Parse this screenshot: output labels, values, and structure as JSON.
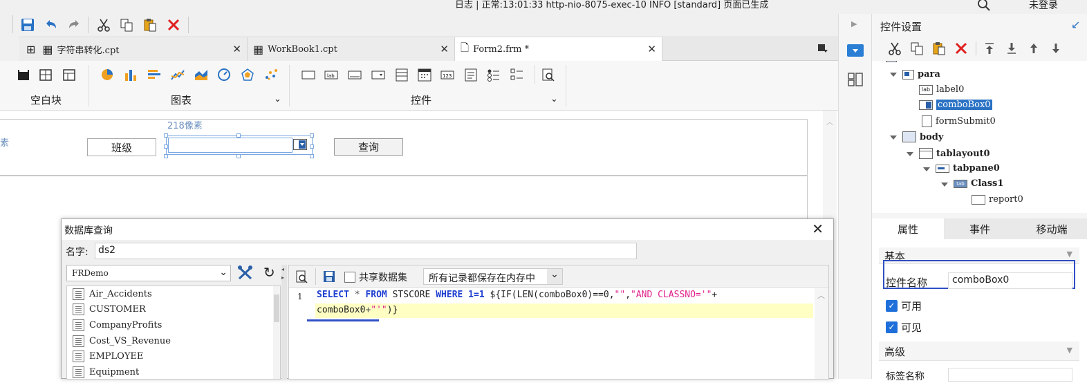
{
  "status": {
    "log_text": "日志 | 正常:13:01:33 http-nio-8075-exec-10 INFO [standard] 页面已生成",
    "login_text": "未登录"
  },
  "tabs": [
    {
      "label": "字符串转化.cpt"
    },
    {
      "label": "WorkBook1.cpt"
    },
    {
      "label": "Form2.frm *"
    }
  ],
  "ribbon": {
    "group1": "空白块",
    "group2": "图表",
    "group3": "控件"
  },
  "canvas": {
    "left_px_label": "素",
    "width_hint": "218像素",
    "class_label": "班级",
    "query_button": "查询"
  },
  "right_panel": {
    "title": "控件设置",
    "tree": [
      {
        "label": "para"
      },
      {
        "label": "label0"
      },
      {
        "label": "comboBox0"
      },
      {
        "label": "formSubmit0"
      },
      {
        "label": "body"
      },
      {
        "label": "tablayout0"
      },
      {
        "label": "tabpane0"
      },
      {
        "label": "Class1"
      },
      {
        "label": "report0"
      }
    ],
    "tabs": [
      "属性",
      "事件",
      "移动端"
    ],
    "section_basic": "基本",
    "widget_name_label": "控件名称",
    "widget_name_value": "comboBox0",
    "enabled_label": "可用",
    "visible_label": "可见",
    "section_advanced": "高级",
    "tag_name_label": "标签名称"
  },
  "dialog": {
    "title": "数据库查询",
    "name_label": "名字:",
    "name_value": "ds2",
    "connection": "FRDemo",
    "tables": [
      "Air_Accidents",
      "CUSTOMER",
      "CompanyProfits",
      "Cost_VS_Revenue",
      "EMPLOYEE",
      "Equipment"
    ],
    "share_label": "共享数据集",
    "cache_option": "所有记录都保存在内存中",
    "line_number": "1",
    "sql_line1": [
      {
        "t": "SELECT",
        "c": "kw"
      },
      {
        "t": " * ",
        "c": "op"
      },
      {
        "t": "FROM",
        "c": "kw"
      },
      {
        "t": " STSCORE ",
        "c": "tx"
      },
      {
        "t": "WHERE",
        "c": "kw"
      },
      {
        "t": " 1=1 ",
        "c": "kwn"
      },
      {
        "t": "${IF(",
        "c": "tx"
      },
      {
        "t": "LEN",
        "c": "tx"
      },
      {
        "t": "(comboBox0)",
        "c": "tx"
      },
      {
        "t": "==0,",
        "c": "tx"
      },
      {
        "t": "\"\"",
        "c": "str"
      },
      {
        "t": ",",
        "c": "tx"
      },
      {
        "t": "\"AND CLASSNO='\"",
        "c": "str"
      },
      {
        "t": "+",
        "c": "tx"
      }
    ],
    "sql_line2": [
      {
        "t": "comboBox0",
        "c": "tx"
      },
      {
        "t": "+",
        "c": "op"
      },
      {
        "t": "\"'\"",
        "c": "str"
      },
      {
        "t": ")}",
        "c": "tx"
      }
    ]
  }
}
